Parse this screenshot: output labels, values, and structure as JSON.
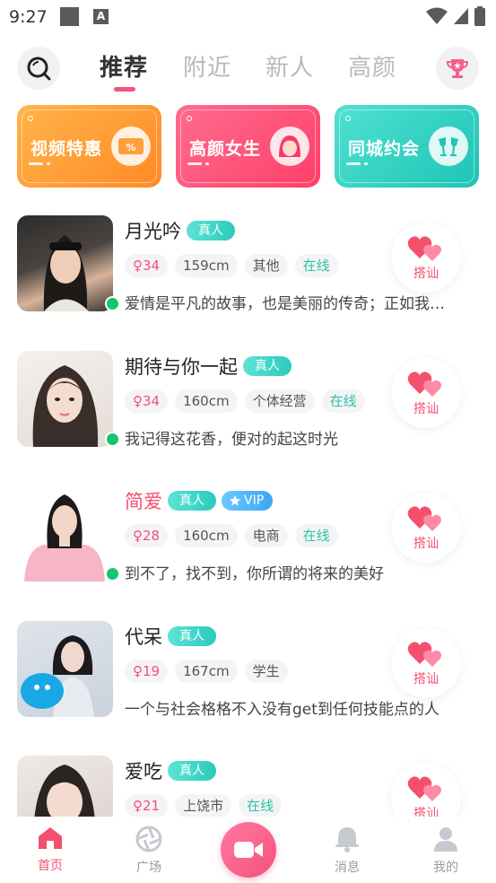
{
  "status_bar": {
    "time": "9:27",
    "a_icon": "A"
  },
  "tabs": [
    {
      "label": "推荐",
      "active": true
    },
    {
      "label": "附近",
      "active": false
    },
    {
      "label": "新人",
      "active": false
    },
    {
      "label": "高颜",
      "active": false
    }
  ],
  "banners": [
    {
      "label": "视频特惠",
      "badge_text": "%",
      "color": "#ff8a25"
    },
    {
      "label": "高颜女生",
      "color": "#ff3f68"
    },
    {
      "label": "同城约会",
      "color": "#1ec4b6"
    }
  ],
  "users": [
    {
      "name": "月光吟",
      "real_tag": "真人",
      "age": "34",
      "height": "159cm",
      "job": "其他",
      "status": "在线",
      "bio": "爱情是平凡的故事，也是美丽的传奇；正如我…",
      "chat_label": "搭讪",
      "online": true
    },
    {
      "name": "期待与你一起",
      "real_tag": "真人",
      "age": "34",
      "height": "160cm",
      "job": "个体经营",
      "status": "在线",
      "bio": "我记得这花香，便对的起这时光",
      "chat_label": "搭讪",
      "online": true
    },
    {
      "name": "简爱",
      "real_tag": "真人",
      "vip_tag": "VIP",
      "age": "28",
      "height": "160cm",
      "job": "电商",
      "status": "在线",
      "bio": "到不了，找不到，你所谓的将来的美好",
      "chat_label": "搭讪",
      "online": true
    },
    {
      "name": "代呆",
      "real_tag": "真人",
      "age": "19",
      "height": "167cm",
      "job": "学生",
      "bio": "一个与社会格格不入没有get到任何技能点的人",
      "chat_label": "搭讪",
      "online": false
    },
    {
      "name": "爱吃",
      "real_tag": "真人",
      "age": "21",
      "location": "上饶市",
      "status": "在线",
      "chat_label": "搭讪",
      "online": false
    }
  ],
  "bottom_nav": [
    {
      "label": "首页",
      "icon": "home-icon",
      "active": true
    },
    {
      "label": "广场",
      "icon": "aperture-icon",
      "active": false
    },
    {
      "label": "",
      "icon": "video-camera-icon",
      "active": false
    },
    {
      "label": "消息",
      "icon": "bell-icon",
      "active": false
    },
    {
      "label": "我的",
      "icon": "person-icon",
      "active": false
    }
  ],
  "colors": {
    "accent": "#f4506e",
    "real_tag": "#2bcabd",
    "online_dot": "#13c66e",
    "vip": "#3aa6f5"
  }
}
